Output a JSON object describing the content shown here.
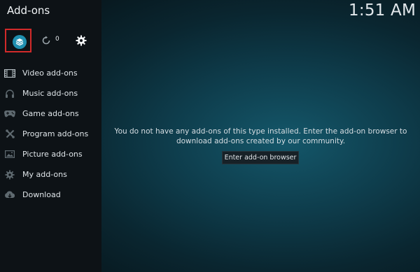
{
  "header": {
    "title": "Add-ons",
    "clock": "1:51 AM"
  },
  "toolbar": {
    "update_count": "0"
  },
  "sidebar": {
    "items": [
      {
        "label": "Video add-ons",
        "icon": "film-icon"
      },
      {
        "label": "Music add-ons",
        "icon": "headphones-icon"
      },
      {
        "label": "Game add-ons",
        "icon": "gamepad-icon"
      },
      {
        "label": "Program add-ons",
        "icon": "tools-icon"
      },
      {
        "label": "Picture add-ons",
        "icon": "picture-icon"
      },
      {
        "label": "My add-ons",
        "icon": "gear-icon"
      },
      {
        "label": "Download",
        "icon": "cloud-download-icon"
      }
    ]
  },
  "main": {
    "message_line1": "You do not have any add-ons of this type installed. Enter the add-on browser to",
    "message_line2": "download add-ons created by our community.",
    "button_label": "Enter add-on browser"
  },
  "colors": {
    "focus": "#d22a2a",
    "accent": "#1f8fb0"
  }
}
